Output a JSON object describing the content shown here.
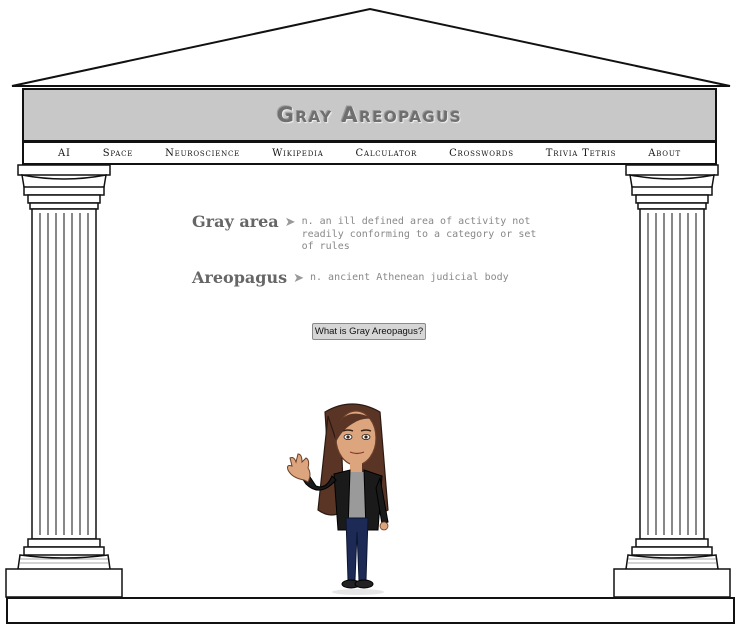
{
  "site": {
    "title": "Gray Areopagus"
  },
  "nav": {
    "items": [
      {
        "label": "AI"
      },
      {
        "label": "Space"
      },
      {
        "label": "Neuroscience"
      },
      {
        "label": "Wikipedia"
      },
      {
        "label": "Calculator"
      },
      {
        "label": "Crosswords"
      },
      {
        "label": "Trivia Tetris"
      },
      {
        "label": "About"
      }
    ]
  },
  "definitions": [
    {
      "term": "Gray area",
      "arrow": "➤",
      "text": "n. an ill defined area of activity not readily conforming to a category or set of rules"
    },
    {
      "term": "Areopagus",
      "arrow": "➤",
      "text": "n. ancient Athenean judicial body"
    }
  ],
  "button": {
    "label": "What is Gray Areopagus?"
  },
  "colors": {
    "banner": "#c8c8c8",
    "title": "#6f6f6f",
    "definition_text": "#888888"
  }
}
